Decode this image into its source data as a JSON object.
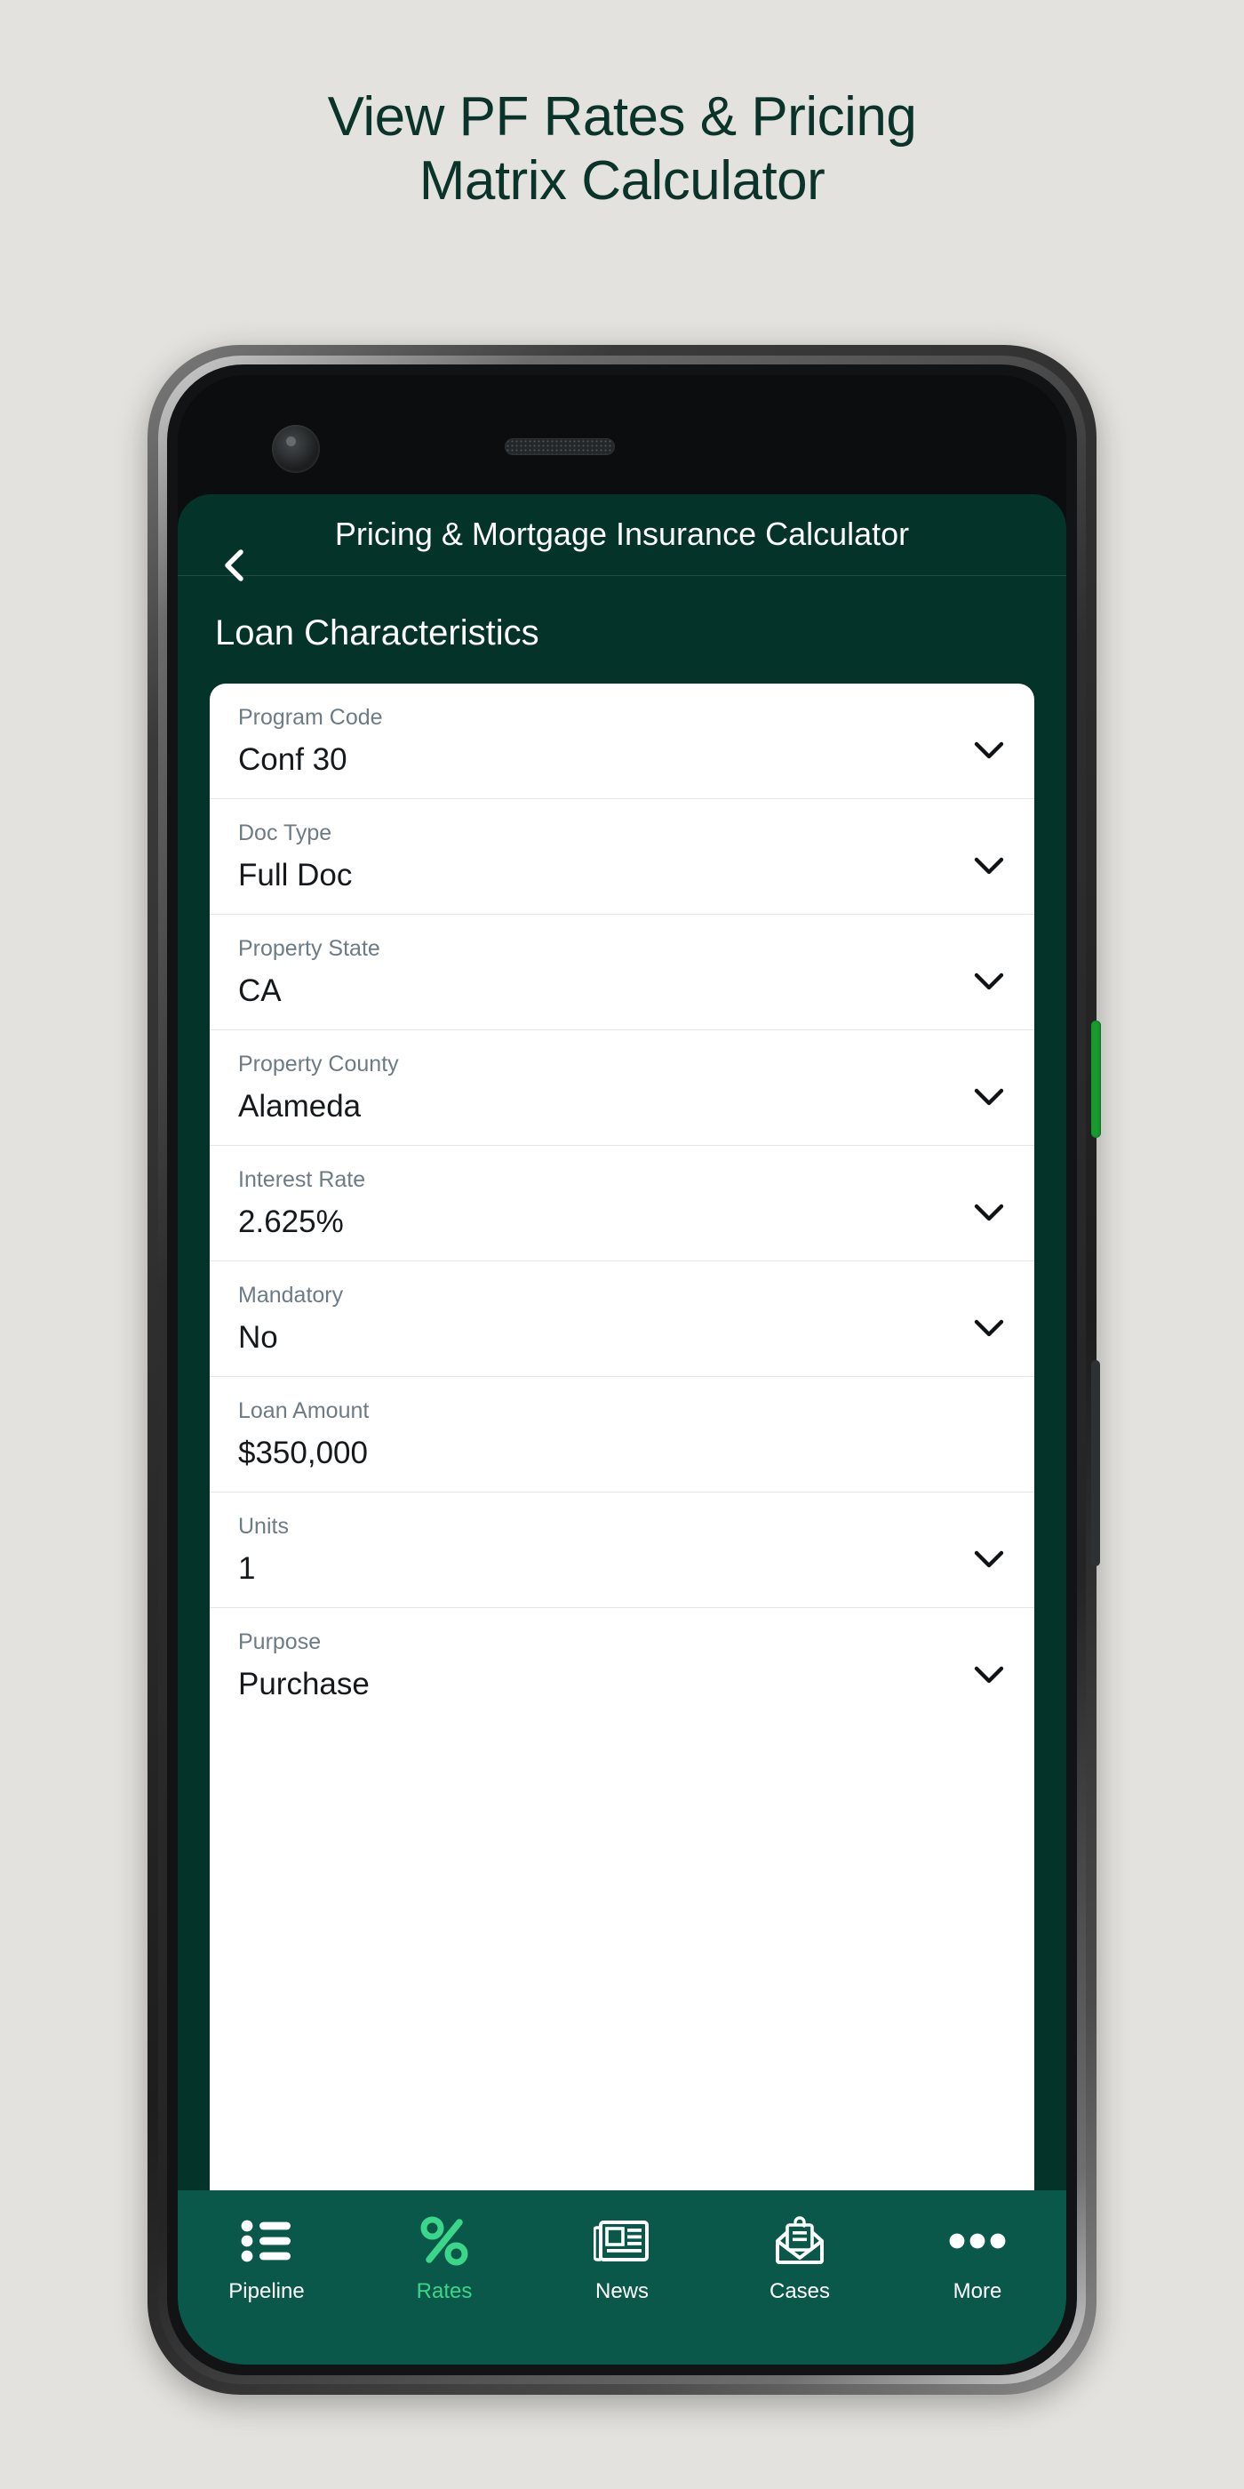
{
  "headline": {
    "line1": "View PF Rates & Pricing",
    "line2": "Matrix Calculator",
    "color": "#0a3429"
  },
  "phone": {
    "hardware": {
      "camera": "front-camera",
      "speaker": "earpiece-speaker",
      "power_button": "power-button",
      "volume_button": "volume-button",
      "power_button_color": "#179b2f"
    }
  },
  "app": {
    "theme": {
      "header_bg": "#04332a",
      "tabbar_bg": "#0a5849",
      "accent": "#3ad68a",
      "card_bg": "#ffffff",
      "label_color": "#6d7b85",
      "value_color": "#15191c"
    },
    "header": {
      "back_icon": "chevron-left-icon",
      "title": "Pricing & Mortgage Insurance Calculator"
    },
    "section_title": "Loan Characteristics",
    "fields": [
      {
        "label": "Program Code",
        "value": "Conf 30",
        "type": "dropdown"
      },
      {
        "label": "Doc Type",
        "value": "Full Doc",
        "type": "dropdown"
      },
      {
        "label": "Property State",
        "value": "CA",
        "type": "dropdown"
      },
      {
        "label": "Property County",
        "value": "Alameda",
        "type": "dropdown"
      },
      {
        "label": "Interest Rate",
        "value": "2.625%",
        "type": "dropdown"
      },
      {
        "label": "Mandatory",
        "value": "No",
        "type": "dropdown"
      },
      {
        "label": "Loan Amount",
        "value": "$350,000",
        "type": "text"
      },
      {
        "label": "Units",
        "value": "1",
        "type": "dropdown"
      },
      {
        "label": "Purpose",
        "value": "Purchase",
        "type": "dropdown"
      }
    ],
    "tabs": [
      {
        "label": "Pipeline",
        "icon": "list-icon",
        "active": false
      },
      {
        "label": "Rates",
        "icon": "percent-icon",
        "active": true
      },
      {
        "label": "News",
        "icon": "newspaper-icon",
        "active": false
      },
      {
        "label": "Cases",
        "icon": "envelope-icon",
        "active": false
      },
      {
        "label": "More",
        "icon": "ellipsis-icon",
        "active": false
      }
    ]
  }
}
